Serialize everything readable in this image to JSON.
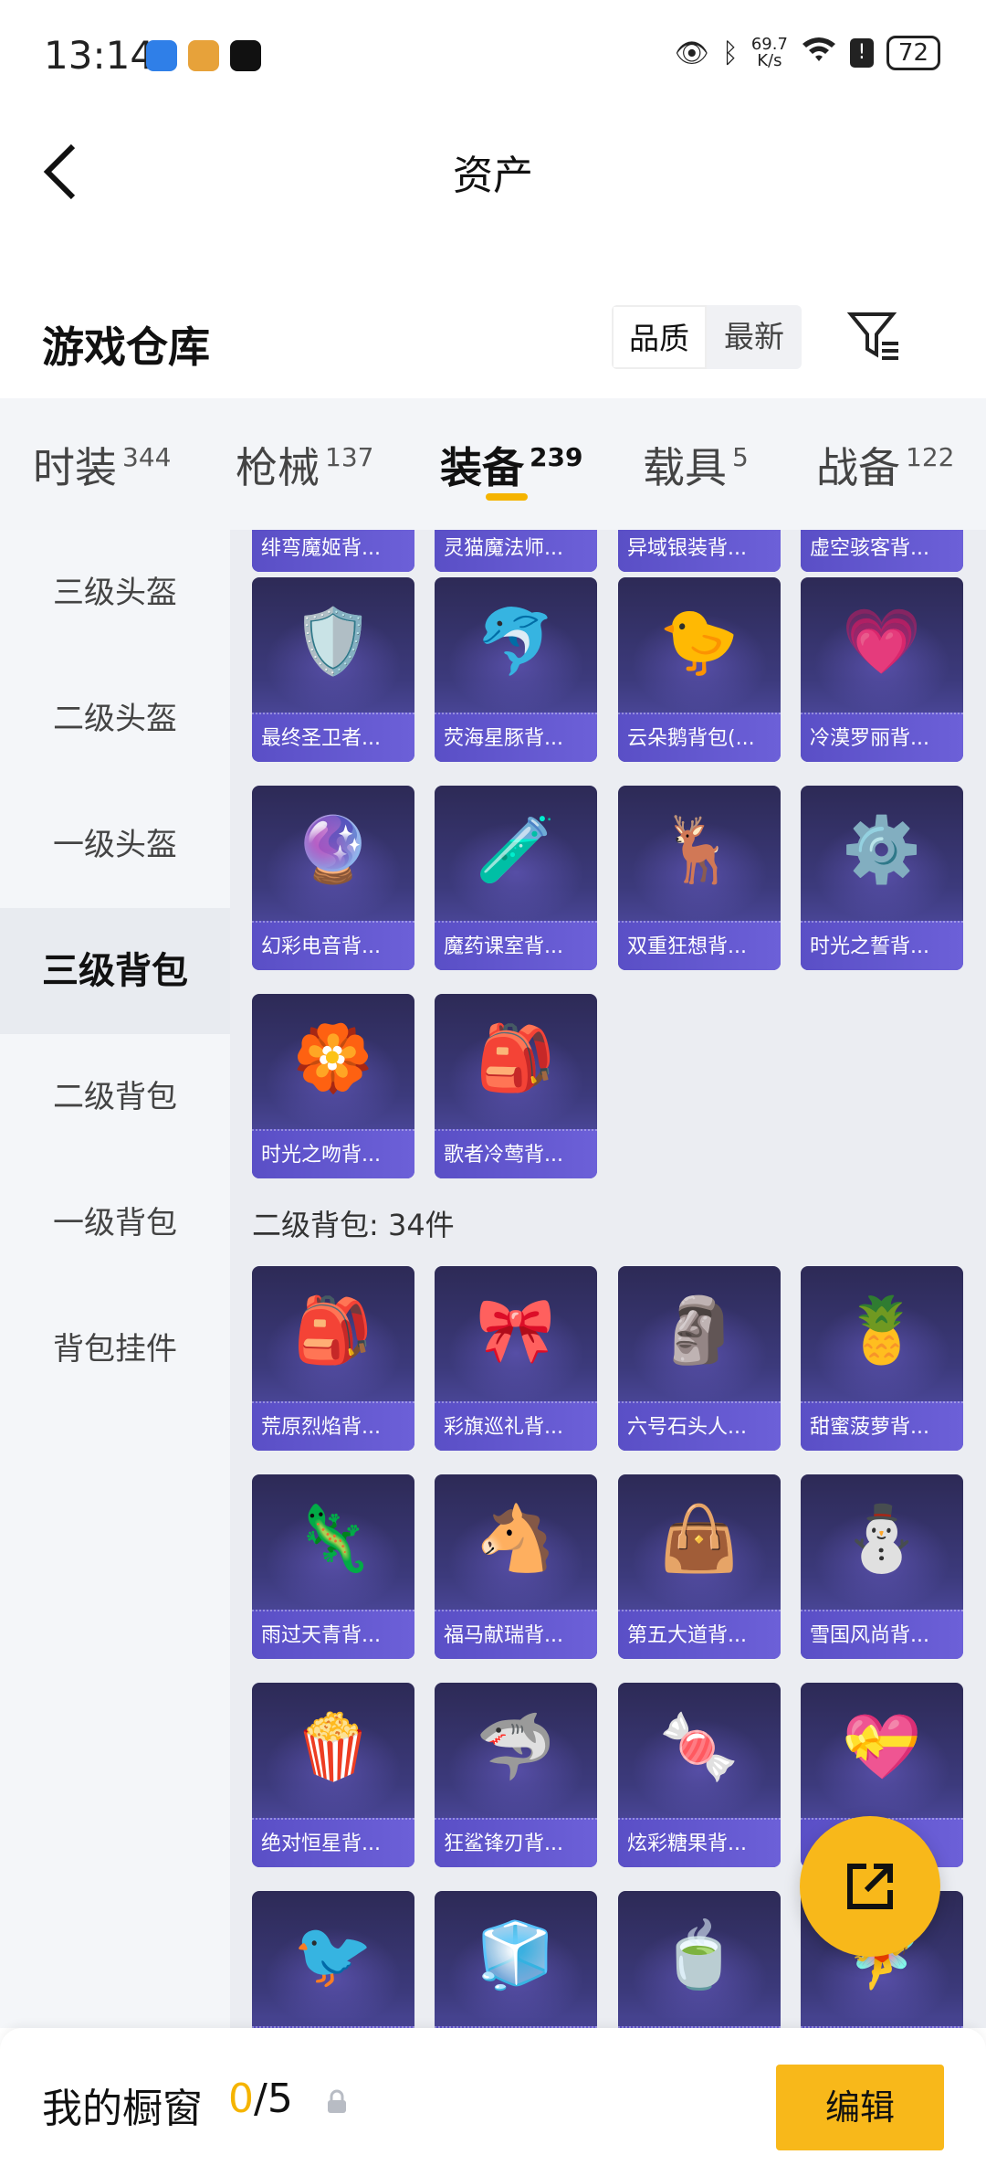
{
  "status_bar": {
    "time": "13:14",
    "net_speed_value": "69.7",
    "net_speed_unit": "K/s",
    "battery": "72"
  },
  "header": {
    "title": "资产"
  },
  "section": {
    "title": "游戏仓库",
    "sort_options": [
      "品质",
      "最新"
    ],
    "active_sort": "品质"
  },
  "tabs": [
    {
      "label": "时装",
      "count": "344"
    },
    {
      "label": "枪械",
      "count": "137"
    },
    {
      "label": "装备",
      "count": "239",
      "active": true
    },
    {
      "label": "载具",
      "count": "5"
    },
    {
      "label": "战备",
      "count": "122"
    }
  ],
  "sidebar": {
    "items": [
      "三级头盔",
      "二级头盔",
      "一级头盔",
      "三级背包",
      "二级背包",
      "一级背包",
      "背包挂件"
    ],
    "active": "三级背包"
  },
  "content": {
    "partial_row": [
      "绯弯魔姬背...",
      "灵猫魔法师...",
      "异域银装背...",
      "虚空骇客背..."
    ],
    "level3_items": [
      {
        "name": "最终圣卫者...",
        "icon": "🛡️"
      },
      {
        "name": "荧海星豚背...",
        "icon": "🐬"
      },
      {
        "name": "云朵鹅背包(...",
        "icon": "🐤"
      },
      {
        "name": "冷漠罗丽背...",
        "icon": "💗"
      },
      {
        "name": "幻彩电音背...",
        "icon": "🔮"
      },
      {
        "name": "魔药课室背...",
        "icon": "🧪"
      },
      {
        "name": "双重狂想背...",
        "icon": "🦌"
      },
      {
        "name": "时光之誓背...",
        "icon": "⚙️"
      },
      {
        "name": "时光之吻背...",
        "icon": "🏵️"
      },
      {
        "name": "歌者冷莺背...",
        "icon": "🎒"
      }
    ],
    "level2_heading": "二级背包: 34件",
    "level2_items": [
      {
        "name": "荒原烈焰背...",
        "icon": "🎒"
      },
      {
        "name": "彩旗巡礼背...",
        "icon": "🎀"
      },
      {
        "name": "六号石头人...",
        "icon": "🗿"
      },
      {
        "name": "甜蜜菠萝背...",
        "icon": "🍍"
      },
      {
        "name": "雨过天青背...",
        "icon": "🦎"
      },
      {
        "name": "福马献瑞背...",
        "icon": "🐴"
      },
      {
        "name": "第五大道背...",
        "icon": "👜"
      },
      {
        "name": "雪国风尚背...",
        "icon": "⛄"
      },
      {
        "name": "绝对恒星背...",
        "icon": "🍿"
      },
      {
        "name": "狂鲨锋刃背...",
        "icon": "🦈"
      },
      {
        "name": "炫彩糖果背...",
        "icon": "🍬"
      },
      {
        "name": "",
        "icon": "💝"
      },
      {
        "name": "",
        "icon": "🐦"
      },
      {
        "name": "",
        "icon": "🧊"
      },
      {
        "name": "",
        "icon": "🍵"
      },
      {
        "name": "",
        "icon": "🧚"
      }
    ]
  },
  "bottom_bar": {
    "title": "我的橱窗",
    "current": "0",
    "total": "/5",
    "edit_label": "编辑"
  },
  "colors": {
    "accent": "#f8b81a",
    "card_bg": "#3c3a7c"
  }
}
